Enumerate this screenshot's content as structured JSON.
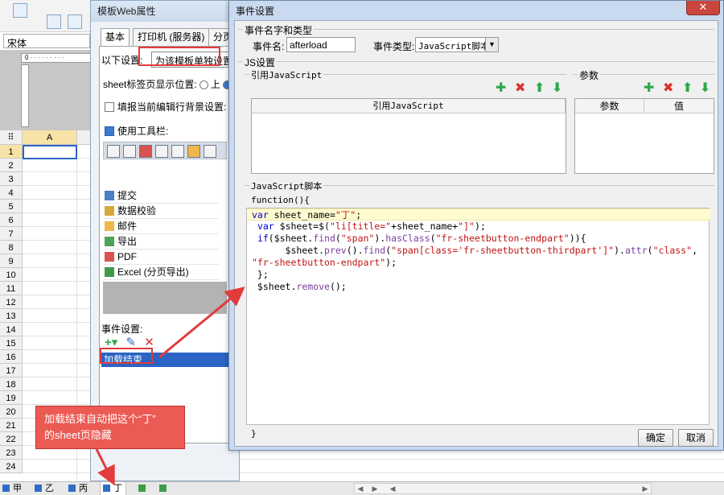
{
  "app": {
    "font_name": "宋体",
    "column_header": "A",
    "row_numbers": [
      "1",
      "2",
      "3",
      "4",
      "5",
      "6",
      "7",
      "8",
      "9",
      "10",
      "11",
      "12",
      "13",
      "14",
      "15",
      "16",
      "17",
      "18",
      "19",
      "20",
      "21",
      "22",
      "23",
      "24"
    ],
    "sheet_tabs": [
      "甲",
      "乙",
      "丙",
      "丁"
    ],
    "active_sheet": "丁"
  },
  "template_dialog": {
    "title": "模板Web属性",
    "tabs": [
      "基本",
      "打印机 (服务器)",
      "分页"
    ],
    "scope_label": "以下设置:",
    "scope_value": "为该模板单独设置",
    "sheet_tab_position_label": "sheet标签页显示位置:",
    "sheet_tab_position_option": "上",
    "fill_bg_label": "填报当前编辑行背景设置:",
    "use_toolbar_label": "使用工具栏:",
    "toolbar_items": [
      "提交",
      "数据校验",
      "邮件",
      "导出",
      "PDF",
      "Excel (分页导出)"
    ],
    "event_settings_label": "事件设置:",
    "event_item": "加载结束"
  },
  "event_dialog": {
    "title": "事件设置",
    "section_name_type": "事件名字和类型",
    "event_name_label": "事件名:",
    "event_name_value": "afterload",
    "event_type_label": "事件类型:",
    "event_type_value": "JavaScript脚本",
    "section_js": "JS设置",
    "section_ref_js": "引用JavaScript",
    "ref_js_column": "引用JavaScript",
    "section_params": "参数",
    "params_col_param": "参数",
    "params_col_value": "值",
    "section_script": "JavaScript脚本",
    "script_open": "function(){",
    "script_close": "}",
    "script_lines": [
      "var sheet_name=\"丁\";",
      " var $sheet=$(\"li[title=\"+sheet_name+\"]\");",
      " if($sheet.find(\"span\").hasClass(\"fr-sheetbutton-endpart\")){",
      "      $sheet.prev().find(\"span[class='fr-sheetbutton-thirdpart']\").attr(\"class\",",
      "\"fr-sheetbutton-endpart\");",
      " };",
      " $sheet.remove();"
    ],
    "ok_label": "确定",
    "cancel_label": "取消"
  },
  "annotation": {
    "line1": "加载结束自动把这个“丁”",
    "line2": "的sheet页隐藏"
  },
  "colors": {
    "accent_blue": "#2a64c4",
    "annotation_red": "#e23b3b",
    "add_green": "#2ea84a",
    "delete_red": "#d63131",
    "code_highlight": "#fffbd0"
  }
}
